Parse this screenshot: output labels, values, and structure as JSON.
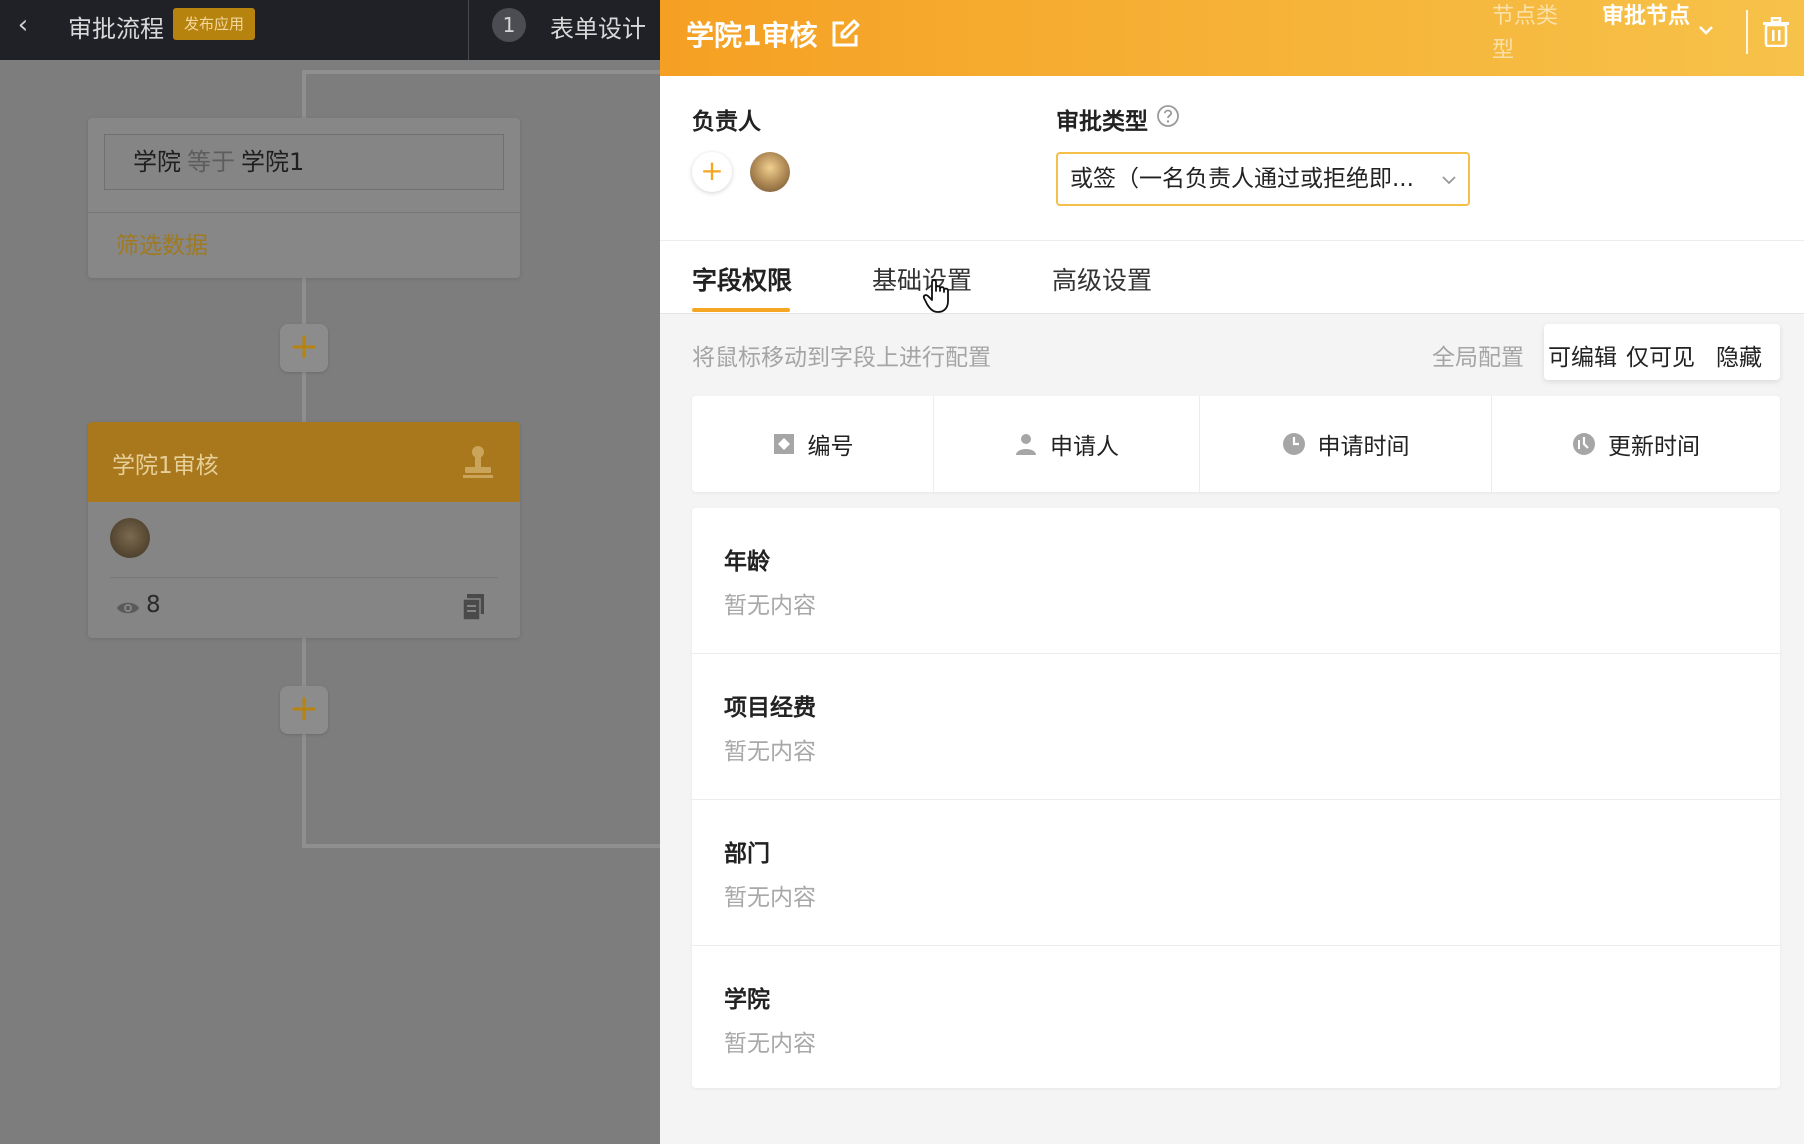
{
  "topbar": {
    "back_icon": "chevron-left-icon",
    "title": "审批流程",
    "publish_badge": "发布应用",
    "step_number": "1",
    "step_label": "表单设计"
  },
  "flow": {
    "condition": {
      "field": "学院",
      "operator": "等于",
      "value": "学院1",
      "filter_link": "筛选数据"
    },
    "node": {
      "title": "学院1审核",
      "view_count": "8"
    }
  },
  "panel": {
    "title": "学院1审核",
    "node_type_label": "节点类型",
    "node_type_value": "审批节点",
    "assignee_label": "负责人",
    "add_assignee": "+",
    "approval_type_label": "审批类型",
    "approval_type_value": "或签（一名负责人通过或拒绝即...",
    "tabs": [
      "字段权限",
      "基础设置",
      "高级设置"
    ],
    "active_tab": "字段权限",
    "hint": "将鼠标移动到字段上进行配置",
    "global_config_label": "全局配置",
    "permission_options": [
      "可编辑",
      "仅可见",
      "隐藏"
    ],
    "system_fields": [
      {
        "label": "编号",
        "icon": "tag-icon"
      },
      {
        "label": "申请人",
        "icon": "person-icon"
      },
      {
        "label": "申请时间",
        "icon": "clock-icon"
      },
      {
        "label": "更新时间",
        "icon": "update-clock-icon"
      }
    ],
    "fields": [
      {
        "name": "年龄",
        "value": "暂无内容"
      },
      {
        "name": "项目经费",
        "value": "暂无内容"
      },
      {
        "name": "部门",
        "value": "暂无内容"
      },
      {
        "name": "学院",
        "value": "暂无内容"
      }
    ]
  },
  "colors": {
    "accent": "#f5a623",
    "header_gradient_start": "#f5a023",
    "header_gradient_end": "#f7c24a",
    "dim_overlay": "#7f7f7f"
  }
}
